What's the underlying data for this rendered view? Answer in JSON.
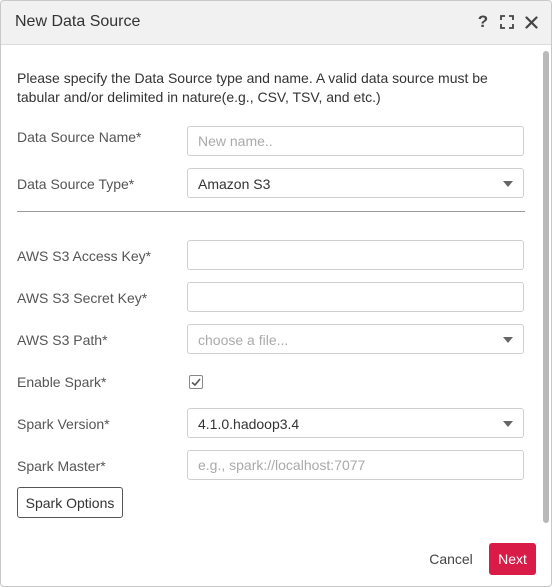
{
  "dialog": {
    "title": "New Data Source",
    "icons": [
      "help-icon",
      "maximize-icon",
      "close-icon"
    ]
  },
  "description": "Please specify the Data Source type and name. A valid data source must be tabular and/or delimited in nature(e.g., CSV, TSV, and etc.)",
  "form": {
    "name_label": "Data Source Name*",
    "name_placeholder": "New name..",
    "name_value": "",
    "type_label": "Data Source Type*",
    "type_value": "Amazon S3",
    "access_key_label": "AWS S3 Access Key*",
    "access_key_value": "",
    "secret_key_label": "AWS S3 Secret Key*",
    "secret_key_value": "",
    "path_label": "AWS S3 Path*",
    "path_placeholder": "choose a file...",
    "spark_enable_label": "Enable Spark*",
    "spark_enabled": true,
    "spark_version_label": "Spark Version*",
    "spark_version_value": "4.1.0.hadoop3.4",
    "spark_master_label": "Spark Master*",
    "spark_master_placeholder": "e.g., spark://localhost:7077",
    "spark_master_value": ""
  },
  "buttons": {
    "spark_options": "Spark Options",
    "cancel": "Cancel",
    "next": "Next"
  },
  "colors": {
    "accent": "#d81b47",
    "titlebar_bg": "#f1f1f1"
  }
}
